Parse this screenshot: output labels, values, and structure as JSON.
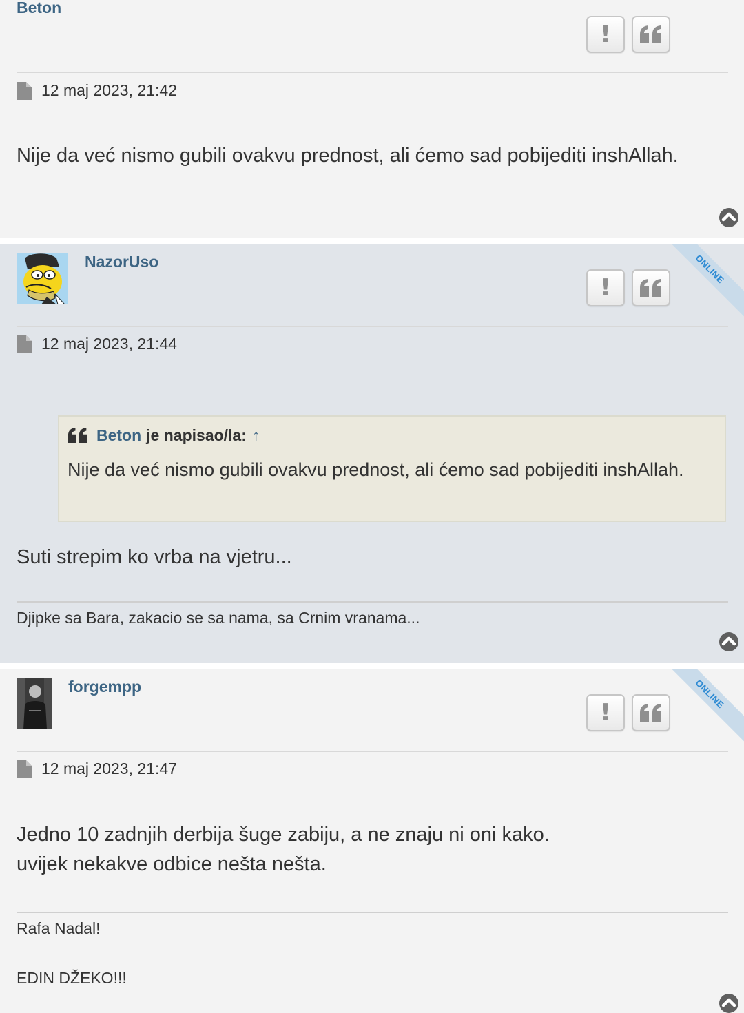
{
  "posts": [
    {
      "author": "Beton",
      "date": "12 maj 2023, 21:42",
      "body": "Nije da već nismo gubili ovakvu prednost, ali ćemo sad pobijediti inshAllah.",
      "online": false,
      "icons": {
        "report": "report-icon",
        "quote": "quote-icon",
        "date": "document-icon",
        "top": "arrow-up-circle-icon"
      }
    },
    {
      "author": "NazorUso",
      "date": "12 maj 2023, 21:44",
      "online": true,
      "online_label": "ONLINE",
      "quote": {
        "author": "Beton",
        "suffix": "je napisao/la:",
        "arrow": "↑",
        "text": "Nije da već nismo gubili ovakvu prednost, ali ćemo sad pobijediti inshAllah."
      },
      "body": "Suti strepim ko vrba na vjetru...",
      "signature": "Djipke sa Bara, zakacio se sa nama, sa Crnim vranama..."
    },
    {
      "author": "forgempp",
      "date": "12 maj 2023, 21:47",
      "online": true,
      "online_label": "ONLINE",
      "body_lines": [
        "Jedno 10 zadnjih derbija šuge zabiju, a ne znaju ni oni kako.",
        "uvijek nekakve odbice nešta nešta."
      ],
      "signature_lines": [
        "Rafa Nadal!",
        "EDIN DŽEKO!!!"
      ]
    }
  ],
  "buttons": {
    "report": "!"
  },
  "colors": {
    "username": "#3d6584",
    "post_bg_1": "#f3f3f3",
    "post_bg_2": "#e1e5ea",
    "quote_bg": "#ebe9dd",
    "online": "#2d8ad3"
  }
}
